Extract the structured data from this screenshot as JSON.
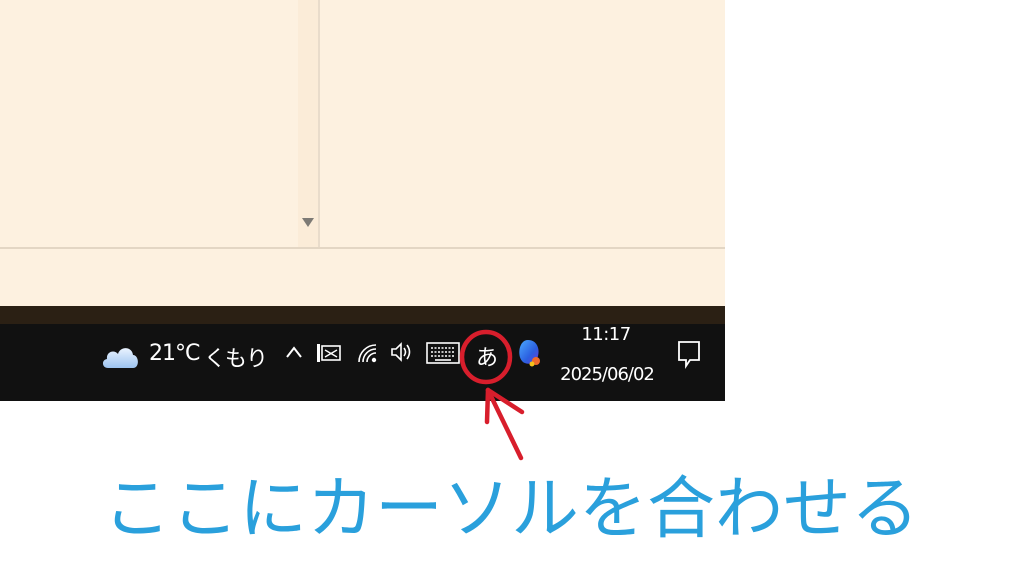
{
  "taskbar": {
    "weather": {
      "icon": "cloud-icon",
      "temperature": "21°C",
      "condition": "くもり"
    },
    "tray_icons": [
      "chevron-up-icon",
      "network-icon",
      "wifi-icon",
      "volume-icon",
      "keyboard-icon",
      "ime-indicator",
      "copilot-icon"
    ],
    "ime_mode": "あ",
    "clock": {
      "time": "11:17",
      "date": "2025/06/02"
    },
    "notification_icon": "notification-icon"
  },
  "annotation": {
    "caption": "ここにカーソルを合わせる",
    "caption_color": "#2aa0dc",
    "highlight_color": "#d81e2c"
  },
  "colors": {
    "window_background": "#fdf1e0",
    "taskbar_background": "#111111",
    "taskbar_top_strip": "#2b2014"
  }
}
